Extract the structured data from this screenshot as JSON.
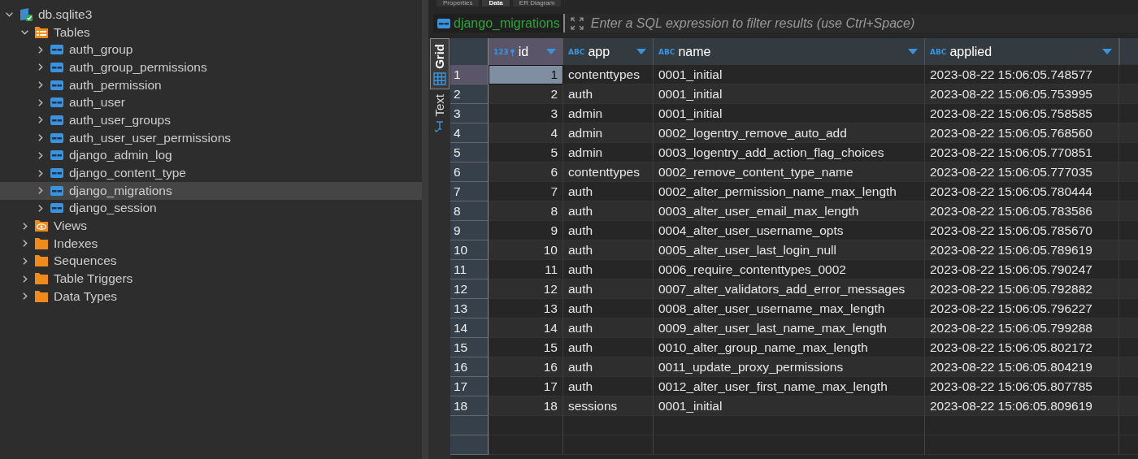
{
  "editor_tabs": [
    {
      "label": "Properties",
      "selected": false
    },
    {
      "label": "Data",
      "selected": true
    },
    {
      "label": "ER Diagram",
      "selected": false
    }
  ],
  "navigator": {
    "tree": [
      {
        "label": "db.sqlite3",
        "kind": "database",
        "expanded": true,
        "selected": false,
        "children": [
          {
            "label": "Tables",
            "kind": "tables",
            "expanded": true,
            "selected": false,
            "children": [
              {
                "label": "auth_group",
                "kind": "table",
                "expanded": false,
                "selected": false
              },
              {
                "label": "auth_group_permissions",
                "kind": "table",
                "expanded": false,
                "selected": false
              },
              {
                "label": "auth_permission",
                "kind": "table",
                "expanded": false,
                "selected": false
              },
              {
                "label": "auth_user",
                "kind": "table",
                "expanded": false,
                "selected": false
              },
              {
                "label": "auth_user_groups",
                "kind": "table",
                "expanded": false,
                "selected": false
              },
              {
                "label": "auth_user_user_permissions",
                "kind": "table",
                "expanded": false,
                "selected": false
              },
              {
                "label": "django_admin_log",
                "kind": "table",
                "expanded": false,
                "selected": false
              },
              {
                "label": "django_content_type",
                "kind": "table",
                "expanded": false,
                "selected": false
              },
              {
                "label": "django_migrations",
                "kind": "table",
                "expanded": false,
                "selected": true
              },
              {
                "label": "django_session",
                "kind": "table",
                "expanded": false,
                "selected": false
              }
            ]
          },
          {
            "label": "Views",
            "kind": "views",
            "expanded": false,
            "selected": false
          },
          {
            "label": "Indexes",
            "kind": "folder",
            "expanded": false,
            "selected": false
          },
          {
            "label": "Sequences",
            "kind": "folder",
            "expanded": false,
            "selected": false
          },
          {
            "label": "Table Triggers",
            "kind": "folder",
            "expanded": false,
            "selected": false
          },
          {
            "label": "Data Types",
            "kind": "folder",
            "expanded": false,
            "selected": false
          }
        ]
      }
    ]
  },
  "filter": {
    "table": "django_migrations",
    "placeholder": "Enter a SQL expression to filter results (use Ctrl+Space)"
  },
  "view_tabs": [
    {
      "label": "Grid",
      "selected": true
    },
    {
      "label": "Text",
      "selected": false
    }
  ],
  "table": {
    "columns": [
      {
        "label": "id",
        "type": "123",
        "key": true
      },
      {
        "label": "app",
        "type": "ABC",
        "key": false
      },
      {
        "label": "name",
        "type": "ABC",
        "key": false
      },
      {
        "label": "applied",
        "type": "ABC",
        "key": false
      }
    ],
    "rows": [
      {
        "num": "1",
        "selected": true,
        "cells": [
          "1",
          "contenttypes",
          "0001_initial",
          "2023-08-22 15:06:05.748577"
        ]
      },
      {
        "num": "2",
        "selected": false,
        "cells": [
          "2",
          "auth",
          "0001_initial",
          "2023-08-22 15:06:05.753995"
        ]
      },
      {
        "num": "3",
        "selected": false,
        "cells": [
          "3",
          "admin",
          "0001_initial",
          "2023-08-22 15:06:05.758585"
        ]
      },
      {
        "num": "4",
        "selected": false,
        "cells": [
          "4",
          "admin",
          "0002_logentry_remove_auto_add",
          "2023-08-22 15:06:05.768560"
        ]
      },
      {
        "num": "5",
        "selected": false,
        "cells": [
          "5",
          "admin",
          "0003_logentry_add_action_flag_choices",
          "2023-08-22 15:06:05.770851"
        ]
      },
      {
        "num": "6",
        "selected": false,
        "cells": [
          "6",
          "contenttypes",
          "0002_remove_content_type_name",
          "2023-08-22 15:06:05.777035"
        ]
      },
      {
        "num": "7",
        "selected": false,
        "cells": [
          "7",
          "auth",
          "0002_alter_permission_name_max_length",
          "2023-08-22 15:06:05.780444"
        ]
      },
      {
        "num": "8",
        "selected": false,
        "cells": [
          "8",
          "auth",
          "0003_alter_user_email_max_length",
          "2023-08-22 15:06:05.783586"
        ]
      },
      {
        "num": "9",
        "selected": false,
        "cells": [
          "9",
          "auth",
          "0004_alter_user_username_opts",
          "2023-08-22 15:06:05.785670"
        ]
      },
      {
        "num": "10",
        "selected": false,
        "cells": [
          "10",
          "auth",
          "0005_alter_user_last_login_null",
          "2023-08-22 15:06:05.789619"
        ]
      },
      {
        "num": "11",
        "selected": false,
        "cells": [
          "11",
          "auth",
          "0006_require_contenttypes_0002",
          "2023-08-22 15:06:05.790247"
        ]
      },
      {
        "num": "12",
        "selected": false,
        "cells": [
          "12",
          "auth",
          "0007_alter_validators_add_error_messages",
          "2023-08-22 15:06:05.792882"
        ]
      },
      {
        "num": "13",
        "selected": false,
        "cells": [
          "13",
          "auth",
          "0008_alter_user_username_max_length",
          "2023-08-22 15:06:05.796227"
        ]
      },
      {
        "num": "14",
        "selected": false,
        "cells": [
          "14",
          "auth",
          "0009_alter_user_last_name_max_length",
          "2023-08-22 15:06:05.799288"
        ]
      },
      {
        "num": "15",
        "selected": false,
        "cells": [
          "15",
          "auth",
          "0010_alter_group_name_max_length",
          "2023-08-22 15:06:05.802172"
        ]
      },
      {
        "num": "16",
        "selected": false,
        "cells": [
          "16",
          "auth",
          "0011_update_proxy_permissions",
          "2023-08-22 15:06:05.804219"
        ]
      },
      {
        "num": "17",
        "selected": false,
        "cells": [
          "17",
          "auth",
          "0012_alter_user_first_name_max_length",
          "2023-08-22 15:06:05.807785"
        ]
      },
      {
        "num": "18",
        "selected": false,
        "cells": [
          "18",
          "sessions",
          "0001_initial",
          "2023-08-22 15:06:05.809619"
        ]
      }
    ]
  }
}
